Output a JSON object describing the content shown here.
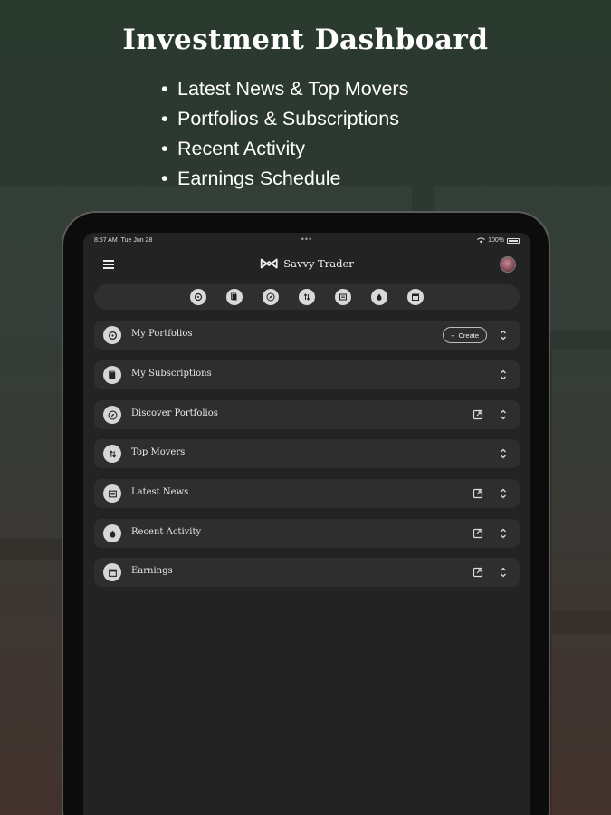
{
  "promo": {
    "title": "Investment Dashboard",
    "bullets": [
      "Latest News & Top Movers",
      "Portfolios & Subscriptions",
      "Recent Activity",
      "Earnings Schedule"
    ],
    "bullet_glyph": "•"
  },
  "status_bar": {
    "time": "8:57 AM",
    "date": "Tue Jun 28",
    "battery": "100%",
    "dots": "•••"
  },
  "app": {
    "name": "Savvy Trader"
  },
  "sections": [
    {
      "label": "My Portfolios",
      "icon": "target-icon",
      "action": "Create"
    },
    {
      "label": "My Subscriptions",
      "icon": "copy-icon"
    },
    {
      "label": "Discover Portfolios",
      "icon": "compass-icon",
      "external": true
    },
    {
      "label": "Top Movers",
      "icon": "sort-arrows-icon"
    },
    {
      "label": "Latest News",
      "icon": "newspaper-icon",
      "external": true
    },
    {
      "label": "Recent Activity",
      "icon": "drop-icon",
      "external": true
    },
    {
      "label": "Earnings",
      "icon": "calendar-icon",
      "external": true
    }
  ],
  "colors": {
    "screen_bg": "#232323",
    "card_bg": "#2e2e2e",
    "icon_fill": "#d6d6d6",
    "text": "#e8e8e8"
  }
}
